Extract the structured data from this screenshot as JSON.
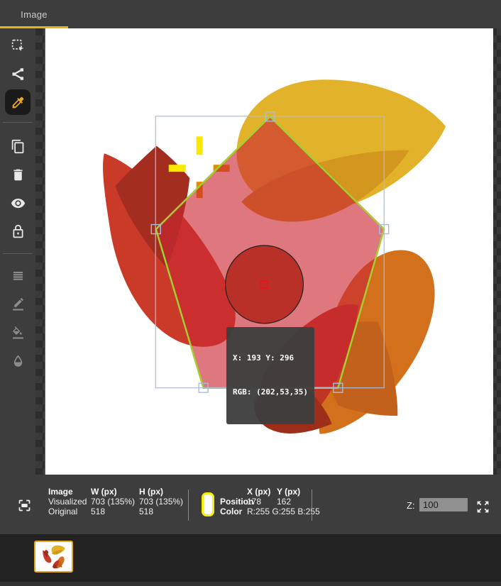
{
  "window": {
    "tab_label": "Image"
  },
  "sidebar": {
    "tools": [
      "rect-select",
      "share",
      "eyedropper",
      "copy",
      "delete",
      "visibility",
      "lock",
      "layers",
      "pencil",
      "fill",
      "droplet"
    ],
    "active_tool": "eyedropper"
  },
  "canvas": {
    "tooltip": {
      "line1": "X: 193 Y: 296",
      "line2": "RGB: (202,53,35)"
    }
  },
  "statusbar": {
    "image_table": {
      "header": {
        "c1": "Image",
        "c2": "W (px)",
        "c3": "H (px)"
      },
      "visualized": {
        "label": "Visualized",
        "w": "703 (135%)",
        "h": "703 (135%)"
      },
      "original": {
        "label": "Original",
        "w": "518",
        "h": "518"
      }
    },
    "pixel_table": {
      "header": {
        "x": "X (px)",
        "y": "Y (px)"
      },
      "position": {
        "label": "Position",
        "x": "178",
        "y": "162"
      },
      "color": {
        "label": "Color",
        "value": "R:255 G:255 B:255"
      }
    },
    "zoom": {
      "label": "Z:",
      "value": "100"
    }
  },
  "colors": {
    "accent_yellow": "#eab511",
    "bar_background": "#3d3d3d",
    "swatch_fill": "#ffffff",
    "swatch_border": "#f5ee0a",
    "pentagon_stroke": "#a3d02f",
    "selection_box": "#a9bdd9",
    "sample_circle": "#b93028",
    "petal_yellow": "#e2b32a",
    "petal_red": "#c93a28",
    "petal_orange": "#d2701c",
    "petal_crimson": "#bf3423"
  }
}
